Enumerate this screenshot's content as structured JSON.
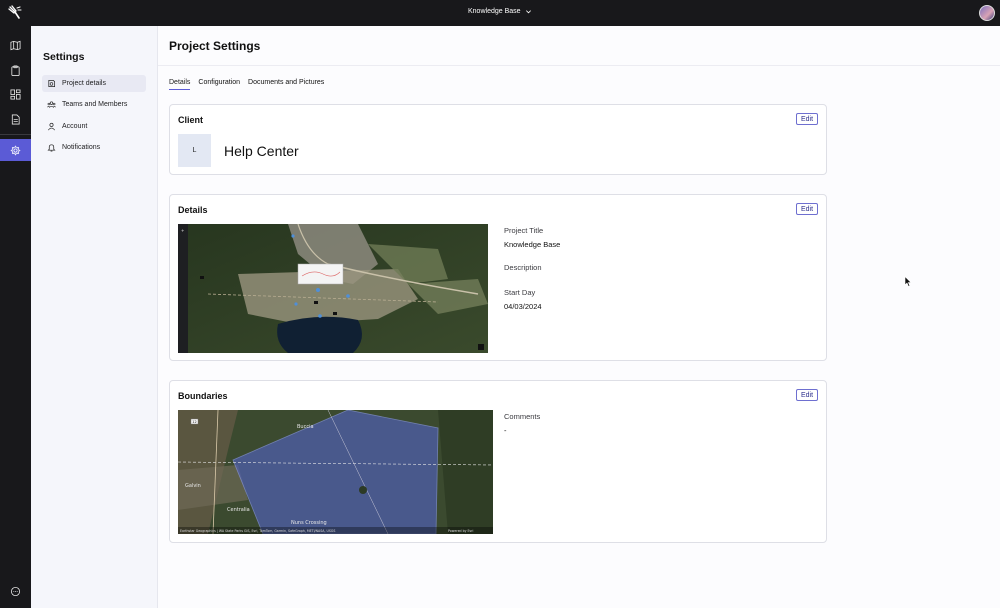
{
  "topbar": {
    "workspace_label": "Knowledge Base"
  },
  "rail": {
    "icons": [
      "map-icon",
      "clipboard-icon",
      "dashboard-icon",
      "document-icon",
      "settings-icon",
      "chat-icon"
    ],
    "active": "settings-icon"
  },
  "sidebar": {
    "title": "Settings",
    "items": [
      {
        "label": "Project details",
        "icon": "project-icon",
        "active": true
      },
      {
        "label": "Teams and Members",
        "icon": "team-icon",
        "active": false
      },
      {
        "label": "Account",
        "icon": "user-icon",
        "active": false
      },
      {
        "label": "Notifications",
        "icon": "bell-icon",
        "active": false
      }
    ]
  },
  "main": {
    "title": "Project Settings",
    "tabs": [
      {
        "label": "Details",
        "active": true
      },
      {
        "label": "Configuration",
        "active": false
      },
      {
        "label": "Documents and Pictures",
        "active": false
      }
    ]
  },
  "client_card": {
    "title": "Client",
    "edit_label": "Edit",
    "logo_letter": "L",
    "client_name": "Help Center"
  },
  "details_card": {
    "title": "Details",
    "edit_label": "Edit",
    "project_title_label": "Project Title",
    "project_title_value": "Knowledge Base",
    "description_label": "Description",
    "start_day_label": "Start Day",
    "start_day_value": "04/03/2024"
  },
  "boundaries_card": {
    "title": "Boundaries",
    "edit_label": "Edit",
    "comments_label": "Comments",
    "comments_value": "-",
    "map_labels": {
      "town_north": "Buccia",
      "town_west": "Galvin",
      "town_south": "Centralia",
      "crossing": "Nuns Crossing",
      "highway": "12",
      "attribution": "Earthstar Geographics | WA State Parks GIS, Esri, TomTom, Garmin, SafeGraph, METI/NASA, USGS",
      "powered_by": "Powered by Esri"
    }
  },
  "colors": {
    "accent": "#5b5bd6",
    "dark": "#18181b",
    "boundary_fill": "#4f5fb0"
  }
}
